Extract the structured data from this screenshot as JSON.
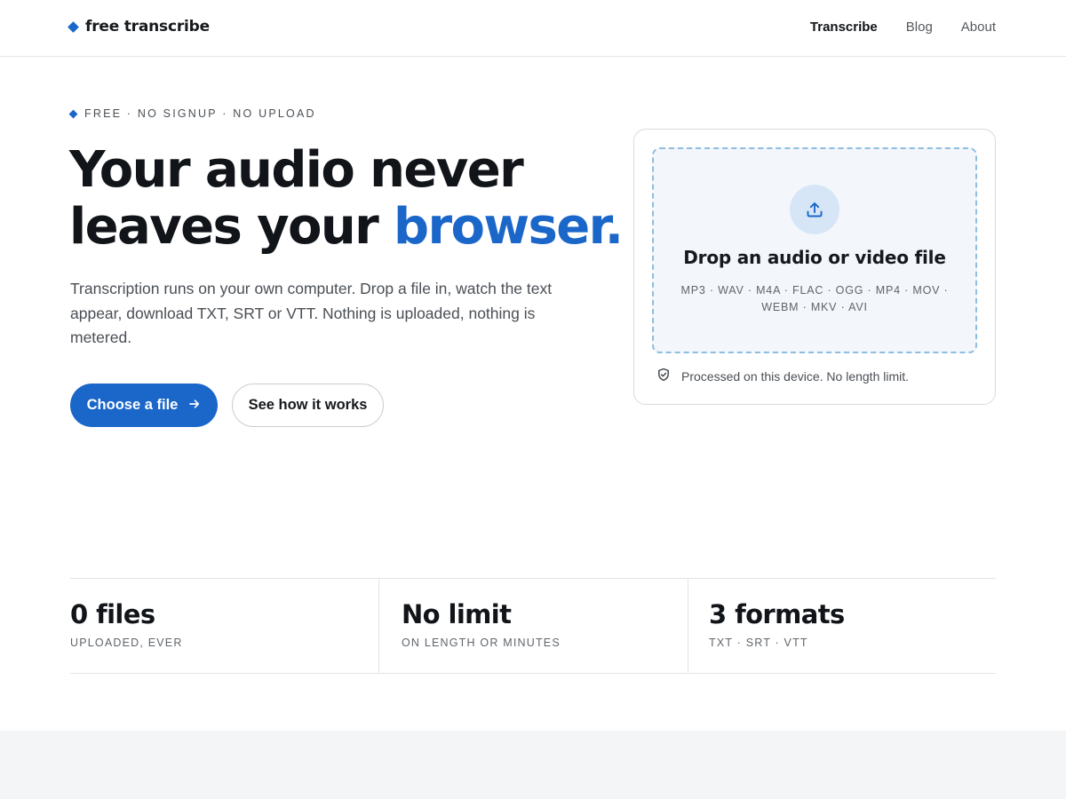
{
  "brand": {
    "name": "free transcribe",
    "accent_color": "#1a66c9"
  },
  "nav": {
    "items": [
      {
        "label": "Transcribe",
        "active": true
      },
      {
        "label": "Blog",
        "active": false
      },
      {
        "label": "About",
        "active": false
      }
    ]
  },
  "hero": {
    "eyebrow": "FREE · NO SIGNUP · NO UPLOAD",
    "title_line1": "Your audio never",
    "title_line2_prefix": "leaves your ",
    "title_line2_accent": "browser.",
    "subtitle": "Transcription runs on your own computer. Drop a file in, watch the text appear, download TXT, SRT or VTT. Nothing is uploaded, nothing is metered.",
    "primary_button": "Choose a file",
    "secondary_button": "See how it works"
  },
  "dropzone": {
    "title": "Drop an audio or video file",
    "formats_line1": "MP3 · WAV · M4A · FLAC · OGG · MP4 · MOV ·",
    "formats_line2": "WEBM · MKV · AVI",
    "privacy_note": "Processed on this device. No length limit.",
    "icons": {
      "upload": "upload-icon",
      "privacy": "shield-check-icon"
    }
  },
  "stats": [
    {
      "value": "0 files",
      "label": "UPLOADED, EVER"
    },
    {
      "value": "No limit",
      "label": "ON LENGTH OR MINUTES"
    },
    {
      "value": "3 formats",
      "label": "TXT · SRT · VTT"
    }
  ]
}
